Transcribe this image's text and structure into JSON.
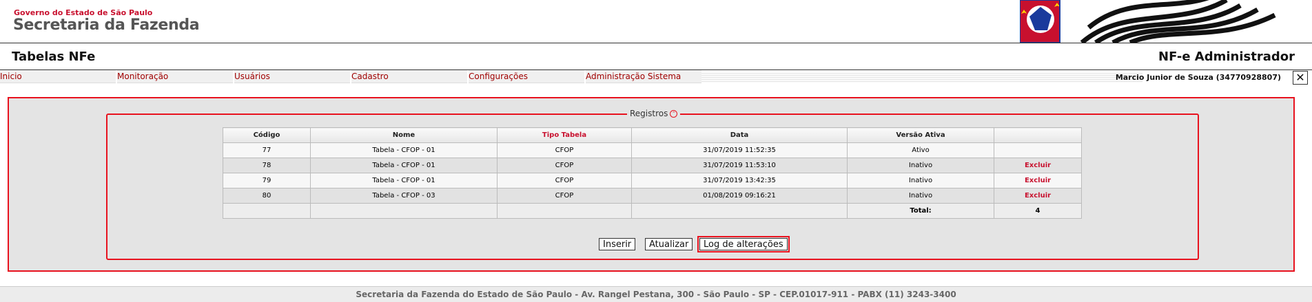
{
  "header": {
    "gov_line": "Governo do Estado de São Paulo",
    "secretaria": "Secretaria da Fazenda"
  },
  "title_bar": {
    "page_title": "Tabelas NFe",
    "app_title": "NF-e Administrador"
  },
  "menu": {
    "items": [
      "Inicio",
      "Monitoração",
      "Usuários",
      "Cadastro",
      "Configurações",
      "Administração Sistema"
    ]
  },
  "user": {
    "name": "Marcio Junior de Souza (34770928807)",
    "close_symbol": "✕"
  },
  "registros": {
    "legend": "Registros",
    "legend_icon": "collapse-circle-icon",
    "columns": [
      "Código",
      "Nome",
      "Tipo Tabela",
      "Data",
      "Versão Ativa",
      ""
    ],
    "rows": [
      {
        "codigo": "77",
        "nome": "Tabela - CFOP - 01",
        "tipo": "CFOP",
        "data": "31/07/2019 11:52:35",
        "versao": "Ativo",
        "acao": ""
      },
      {
        "codigo": "78",
        "nome": "Tabela - CFOP - 01",
        "tipo": "CFOP",
        "data": "31/07/2019 11:53:10",
        "versao": "Inativo",
        "acao": "Excluir"
      },
      {
        "codigo": "79",
        "nome": "Tabela - CFOP - 01",
        "tipo": "CFOP",
        "data": "31/07/2019 13:42:35",
        "versao": "Inativo",
        "acao": "Excluir"
      },
      {
        "codigo": "80",
        "nome": "Tabela - CFOP - 03",
        "tipo": "CFOP",
        "data": "01/08/2019 09:16:21",
        "versao": "Inativo",
        "acao": "Excluir"
      }
    ],
    "total_label": "Total:",
    "total_value": "4"
  },
  "buttons": {
    "inserir": "Inserir",
    "atualizar": "Atualizar",
    "log": "Log de alterações"
  },
  "footer": {
    "text": "Secretaria da Fazenda do Estado de São Paulo - Av. Rangel Pestana, 300 - São Paulo - SP - CEP.01017-911 - PABX (11) 3243-3400"
  },
  "colors": {
    "accent_red": "#e8121e",
    "link_red": "#c8102e"
  }
}
